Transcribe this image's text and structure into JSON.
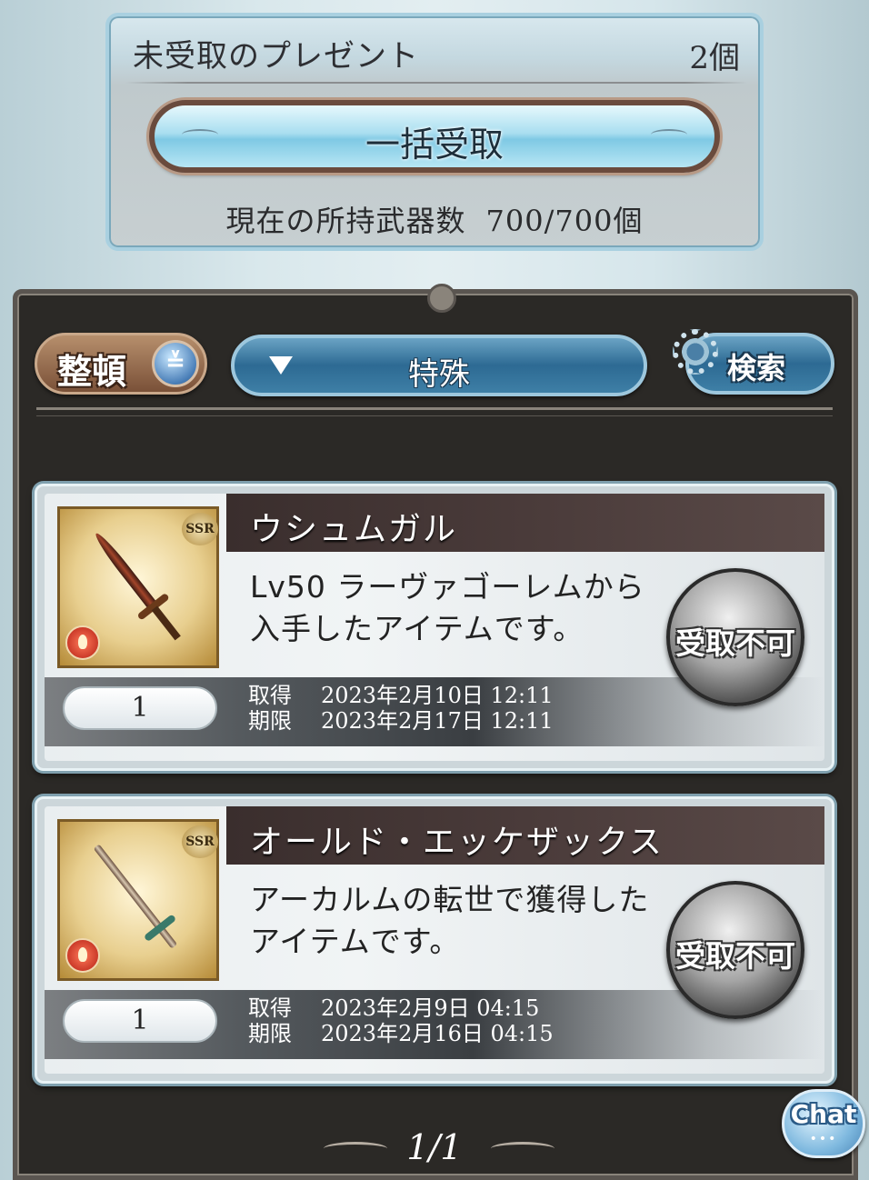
{
  "present_panel": {
    "title": "未受取のプレゼント",
    "count": "2個",
    "bulk_receive_label": "一括受取",
    "weapons_label": "現在の所持武器数",
    "weapons_value": "700/700個"
  },
  "toolbar": {
    "sort_label": "整頓",
    "filter_label": "特殊",
    "search_label": "検索"
  },
  "items": [
    {
      "name": "ウシュムガル",
      "description": "Lv50 ラーヴァゴーレムから入手したアイテムです。",
      "quantity": "1",
      "acquired_label": "取得",
      "acquired_date": "2023年2月10日 12:11",
      "expires_label": "期限",
      "expires_date": "2023年2月17日 12:11",
      "claim_label": "受取不可",
      "rarity": "SSR",
      "element": "fire",
      "icon": "sword-icon"
    },
    {
      "name": "オールド・エッケザックス",
      "description": "アーカルムの転世で獲得したアイテムです。",
      "quantity": "1",
      "acquired_label": "取得",
      "acquired_date": "2023年2月9日 04:15",
      "expires_label": "期限",
      "expires_date": "2023年2月16日 04:15",
      "claim_label": "受取不可",
      "rarity": "SSR",
      "element": "fire",
      "icon": "staff-icon"
    }
  ],
  "pager": {
    "text": "1/1"
  },
  "chat": {
    "label": "Chat"
  }
}
